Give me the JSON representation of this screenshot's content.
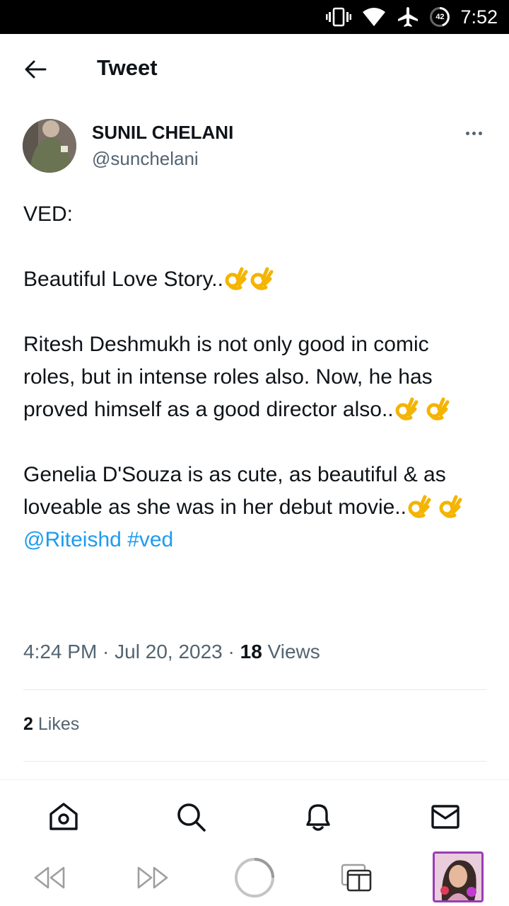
{
  "status_bar": {
    "battery_level": "42",
    "time": "7:52"
  },
  "header": {
    "title": "Tweet"
  },
  "author": {
    "name": "SUNIL CHELANI",
    "handle": "@sunchelani"
  },
  "tweet": {
    "line_ved": "VED:",
    "line_story": "Beautiful Love Story..",
    "para_ritesh": "Ritesh Deshmukh is not only good in comic roles, but in intense roles also. Now, he has proved himself as a good director also..",
    "para_genelia": "Genelia D'Souza is as cute, as beautiful & as loveable as she was in her debut movie..",
    "mention": "@Riteishd",
    "hashtag": "#ved"
  },
  "meta": {
    "time": "4:24 PM",
    "date": "Jul 20, 2023",
    "views_count": "18",
    "views_label": "Views"
  },
  "stats": {
    "likes_count": "2",
    "likes_label": "Likes"
  },
  "icons": {
    "back": "arrow-left-icon",
    "more": "more-horizontal-icon",
    "ok_hand": "ok-hand-emoji",
    "home": "home-icon",
    "search": "search-icon",
    "notifications": "bell-icon",
    "messages": "mail-icon",
    "browser_back": "rewind-icon",
    "browser_forward": "fast-forward-icon",
    "loading": "loading-spinner-icon",
    "tabs": "tabs-icon"
  },
  "colors": {
    "link": "#1d9bf0",
    "text": "#0f1419",
    "secondary": "#536471",
    "thumb_border": "#9b3bb6"
  }
}
